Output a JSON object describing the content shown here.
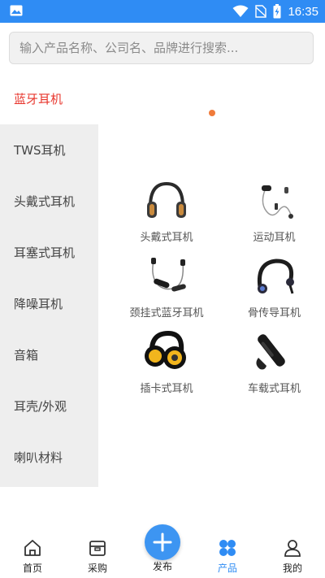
{
  "status_bar": {
    "time": "16:35",
    "icons": [
      "image-icon",
      "wifi-icon",
      "no-sim-icon",
      "battery-charging-icon"
    ]
  },
  "search": {
    "placeholder": "输入产品名称、公司名、品牌进行搜索..."
  },
  "sidebar": {
    "items": [
      {
        "label": "蓝牙耳机",
        "active": true
      },
      {
        "label": "TWS耳机",
        "active": false
      },
      {
        "label": "头戴式耳机",
        "active": false
      },
      {
        "label": "耳塞式耳机",
        "active": false
      },
      {
        "label": "降噪耳机",
        "active": false
      },
      {
        "label": "音箱",
        "active": false
      },
      {
        "label": "耳壳/外观",
        "active": false
      },
      {
        "label": "喇叭材料",
        "active": false
      }
    ]
  },
  "products": [
    {
      "label": "头戴式耳机",
      "icon": "over-ear-headphones-icon"
    },
    {
      "label": "运动耳机",
      "icon": "sport-earphones-icon"
    },
    {
      "label": "颈挂式蓝牙耳机",
      "icon": "neckband-earphones-icon"
    },
    {
      "label": "骨传导耳机",
      "icon": "bone-conduction-headphones-icon"
    },
    {
      "label": "插卡式耳机",
      "icon": "card-slot-headphones-icon"
    },
    {
      "label": "车载式耳机",
      "icon": "car-bluetooth-headset-icon"
    }
  ],
  "bottom_nav": {
    "items": [
      {
        "label": "首页",
        "icon": "home-icon",
        "active": false
      },
      {
        "label": "采购",
        "icon": "box-icon",
        "active": false
      },
      {
        "label": "发布",
        "icon": "plus-icon",
        "active": false
      },
      {
        "label": "产品",
        "icon": "products-icon",
        "active": true
      },
      {
        "label": "我的",
        "icon": "user-icon",
        "active": false
      }
    ]
  },
  "colors": {
    "accent": "#2f8cf4",
    "active_category": "#e8362d",
    "indicator_dot": "#f07b3a"
  }
}
